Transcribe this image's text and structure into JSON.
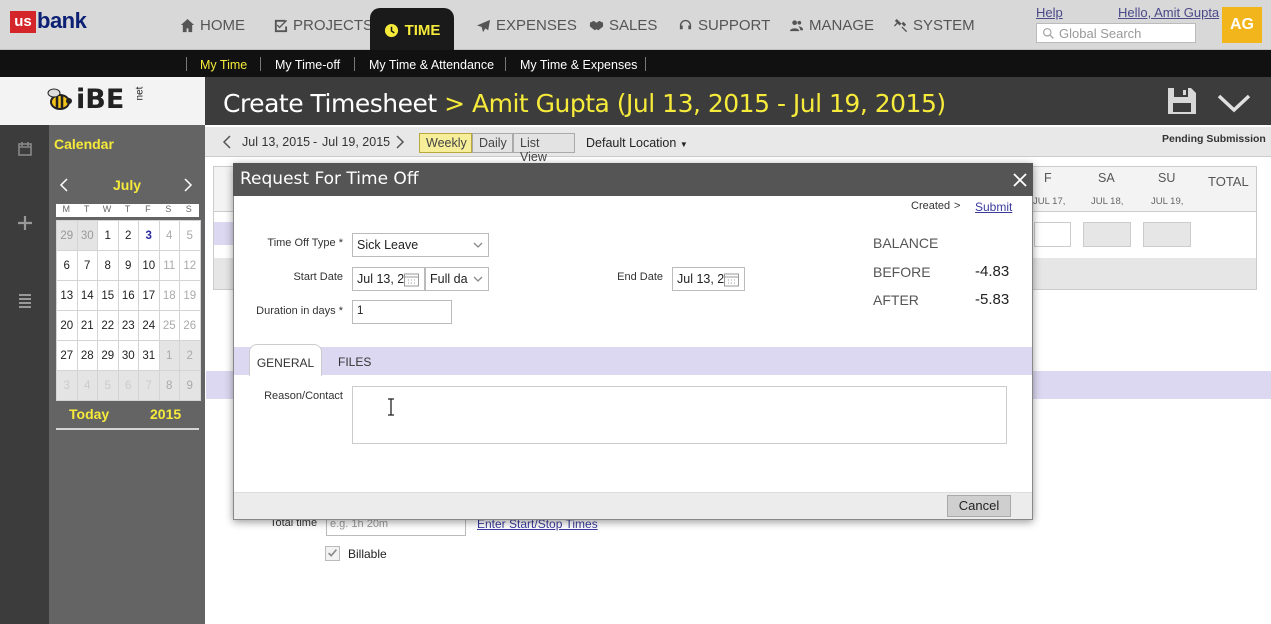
{
  "brand": {
    "logo_us": "us",
    "logo_bank": "bank",
    "product": "iBE",
    "product_suffix": "net"
  },
  "nav": {
    "items": [
      {
        "label": "HOME",
        "icon": "home-icon"
      },
      {
        "label": "PROJECTS",
        "icon": "checkbox-icon"
      },
      {
        "label": "TIME",
        "icon": "clock-icon",
        "active": true
      },
      {
        "label": "EXPENSES",
        "icon": "plane-icon"
      },
      {
        "label": "SALES",
        "icon": "handshake-icon"
      },
      {
        "label": "SUPPORT",
        "icon": "headset-icon"
      },
      {
        "label": "MANAGE",
        "icon": "people-icon"
      },
      {
        "label": "SYSTEM",
        "icon": "tools-icon"
      }
    ],
    "help": "Help",
    "hello": "Hello, Amit Gupta",
    "search_placeholder": "Global Search",
    "avatar": "AG"
  },
  "subnav": [
    "My Time",
    "My Time-off",
    "My Time & Attendance",
    "My Time & Expenses"
  ],
  "page": {
    "title": "Create Timesheet",
    "separator": ">",
    "subject": "Amit Gupta (Jul 13, 2015 - Jul 19, 2015)",
    "date_range_start": "Jul 13, 2015",
    "date_range_dash": "-",
    "date_range_end": "Jul 19, 2015",
    "views": [
      "Weekly",
      "Daily",
      "List View"
    ],
    "location": "Default Location",
    "status": "Pending Submission"
  },
  "grid": {
    "days": [
      {
        "abbr": "F",
        "date": "JUL 17,"
      },
      {
        "abbr": "SA",
        "date": "JUL 18,"
      },
      {
        "abbr": "SU",
        "date": "JUL 19,"
      }
    ],
    "total": "TOTAL"
  },
  "calendar": {
    "heading": "Calendar",
    "month": "July",
    "weekdays": [
      "M",
      "T",
      "W",
      "T",
      "F",
      "S",
      "S"
    ],
    "weeks": [
      [
        "29",
        "30",
        "1",
        "2",
        "3",
        "4",
        "5"
      ],
      [
        "6",
        "7",
        "8",
        "9",
        "10",
        "11",
        "12"
      ],
      [
        "13",
        "14",
        "15",
        "16",
        "17",
        "18",
        "19"
      ],
      [
        "20",
        "21",
        "22",
        "23",
        "24",
        "25",
        "26"
      ],
      [
        "27",
        "28",
        "29",
        "30",
        "31",
        "1",
        "2"
      ],
      [
        "3",
        "4",
        "5",
        "6",
        "7",
        "8",
        "9"
      ]
    ],
    "today_label": "Today",
    "year": "2015"
  },
  "modal": {
    "title": "Request For Time Off",
    "created": "Created",
    "created_sep": ">",
    "submit": "Submit",
    "type_label": "Time Off Type *",
    "type_value": "Sick Leave",
    "start_label": "Start Date",
    "start_value": "Jul 13, 20",
    "day_value": "Full da",
    "end_label": "End Date",
    "end_value": "Jul 13, 20",
    "duration_label": "Duration in days *",
    "duration_value": "1",
    "balance_label": "BALANCE",
    "before_label": "BEFORE",
    "before_value": "-4.83",
    "after_label": "AFTER",
    "after_value": "-5.83",
    "tabs": [
      "GENERAL",
      "FILES"
    ],
    "reason_label": "Reason/Contact",
    "cancel": "Cancel"
  },
  "below": {
    "total_time_label": "Total time",
    "total_time_placeholder": "e.g. 1h 20m",
    "start_stop_link": "Enter Start/Stop Times",
    "billable": "Billable"
  },
  "colors": {
    "accent_yellow": "#f6ea3a",
    "dark": "#3c3c3c",
    "tab_purple": "#dcd8f2",
    "link": "#3b3b9e"
  }
}
